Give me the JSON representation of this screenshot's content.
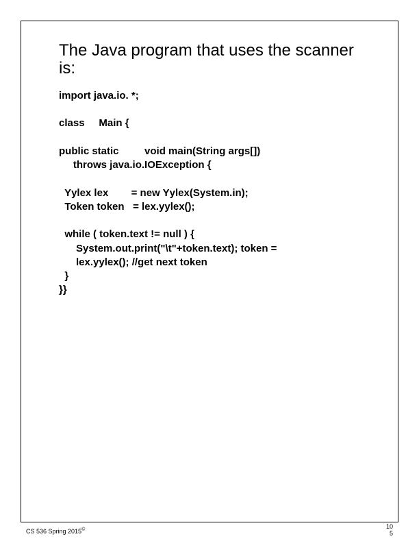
{
  "title": "The Java program that uses the scanner is:",
  "code": {
    "line1": "import java.io. *;",
    "line2": "class     Main {",
    "line3": "public static         void main(String args[])",
    "line4": "     throws java.io.IOException {",
    "line5": "  Yylex lex        = new Yylex(System.in);",
    "line6": "  Token token   = lex.yylex();",
    "line7": "  while ( token.text != null ) {",
    "line8": "      System.out.print(\"\\t\"+token.text); token =",
    "line9": "      lex.yylex(); //get next token",
    "line10": "  }",
    "line11": "}}"
  },
  "footer": {
    "course": "CS 536  Spring 2015",
    "copyright": "©",
    "page_top": "10",
    "page_bottom": "5"
  }
}
